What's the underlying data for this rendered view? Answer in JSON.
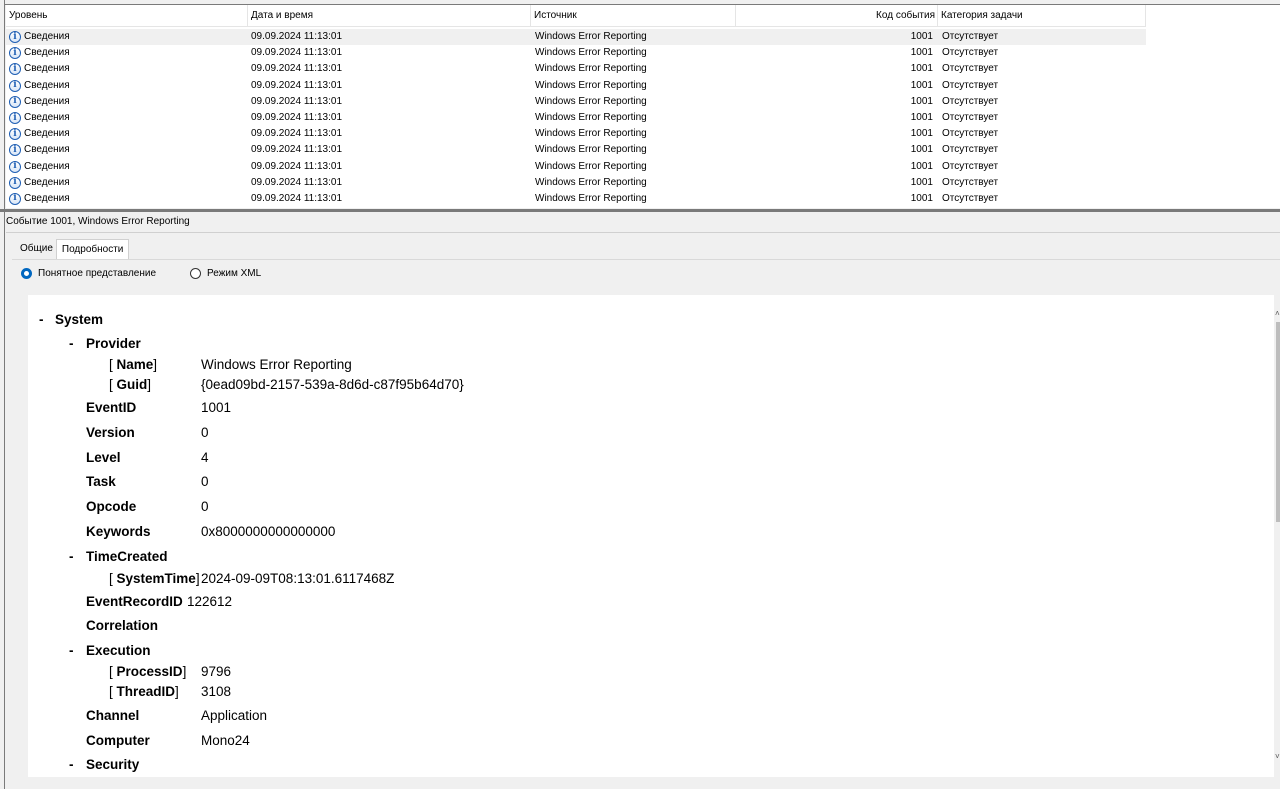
{
  "columns": {
    "level": "Уровень",
    "datetime": "Дата и время",
    "source": "Источник",
    "event_code": "Код события",
    "task_category": "Категория задачи"
  },
  "rows": [
    {
      "level": "Сведения",
      "datetime": "09.09.2024 11:13:01",
      "source": "Windows Error Reporting",
      "code": "1001",
      "category": "Отсутствует"
    },
    {
      "level": "Сведения",
      "datetime": "09.09.2024 11:13:01",
      "source": "Windows Error Reporting",
      "code": "1001",
      "category": "Отсутствует"
    },
    {
      "level": "Сведения",
      "datetime": "09.09.2024 11:13:01",
      "source": "Windows Error Reporting",
      "code": "1001",
      "category": "Отсутствует"
    },
    {
      "level": "Сведения",
      "datetime": "09.09.2024 11:13:01",
      "source": "Windows Error Reporting",
      "code": "1001",
      "category": "Отсутствует"
    },
    {
      "level": "Сведения",
      "datetime": "09.09.2024 11:13:01",
      "source": "Windows Error Reporting",
      "code": "1001",
      "category": "Отсутствует"
    },
    {
      "level": "Сведения",
      "datetime": "09.09.2024 11:13:01",
      "source": "Windows Error Reporting",
      "code": "1001",
      "category": "Отсутствует"
    },
    {
      "level": "Сведения",
      "datetime": "09.09.2024 11:13:01",
      "source": "Windows Error Reporting",
      "code": "1001",
      "category": "Отсутствует"
    },
    {
      "level": "Сведения",
      "datetime": "09.09.2024 11:13:01",
      "source": "Windows Error Reporting",
      "code": "1001",
      "category": "Отсутствует"
    },
    {
      "level": "Сведения",
      "datetime": "09.09.2024 11:13:01",
      "source": "Windows Error Reporting",
      "code": "1001",
      "category": "Отсутствует"
    },
    {
      "level": "Сведения",
      "datetime": "09.09.2024 11:13:01",
      "source": "Windows Error Reporting",
      "code": "1001",
      "category": "Отсутствует"
    },
    {
      "level": "Сведения",
      "datetime": "09.09.2024 11:13:01",
      "source": "Windows Error Reporting",
      "code": "1001",
      "category": "Отсутствует"
    }
  ],
  "info_icon_glyph": "i",
  "preview": {
    "title": "Событие 1001, Windows Error Reporting",
    "tabs": [
      "Общие",
      "Подробности"
    ],
    "active_tab": "Подробности",
    "view_friendly": "Понятное представление",
    "view_xml": "Режим XML",
    "selected_view": "Понятное представление"
  },
  "details": {
    "system": "System",
    "provider": "Provider",
    "name_key": "Name",
    "name_val": "Windows Error Reporting",
    "guid_key": "Guid",
    "guid_val": "{0ead09bd-2157-539a-8d6d-c87f95b64d70}",
    "eventid_key": "EventID",
    "eventid_val": "1001",
    "version_key": "Version",
    "version_val": "0",
    "level_key": "Level",
    "level_val": "4",
    "task_key": "Task",
    "task_val": "0",
    "opcode_key": "Opcode",
    "opcode_val": "0",
    "keywords_key": "Keywords",
    "keywords_val": "0x8000000000000000",
    "timecreated": "TimeCreated",
    "systemtime_key": "SystemTime",
    "systemtime_val": "2024-09-09T08:13:01.6117468Z",
    "recordid_key": "EventRecordID",
    "recordid_val": "122612",
    "correlation_key": "Correlation",
    "execution": "Execution",
    "processid_key": "ProcessID",
    "processid_val": "9796",
    "threadid_key": "ThreadID",
    "threadid_val": "3108",
    "channel_key": "Channel",
    "channel_val": "Application",
    "computer_key": "Computer",
    "computer_val": "Mono24",
    "security": "Security"
  }
}
